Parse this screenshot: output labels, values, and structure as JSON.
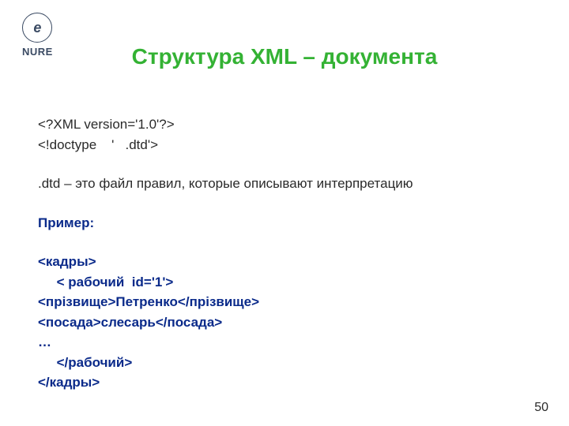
{
  "logo": {
    "inner": "e",
    "label": "NURE"
  },
  "title": "Структура XML – документа",
  "code": {
    "line1": "<?XML version='1.0'?>",
    "line2": "<!doctype    '   .dtd'>"
  },
  "dtd_desc": ".dtd – это файл правил, которые описывают интерпретацию",
  "example_label": "Пример:",
  "example": {
    "line1": "<кадры>",
    "line2": "     < рабочий  id='1'>",
    "line3": "<прізвище>Петренко</прізвище>",
    "line4": "<посада>слесарь</посада>",
    "line5": "…",
    "line6": "     </рабочий>",
    "line7": "</кадры>"
  },
  "page_number": "50"
}
